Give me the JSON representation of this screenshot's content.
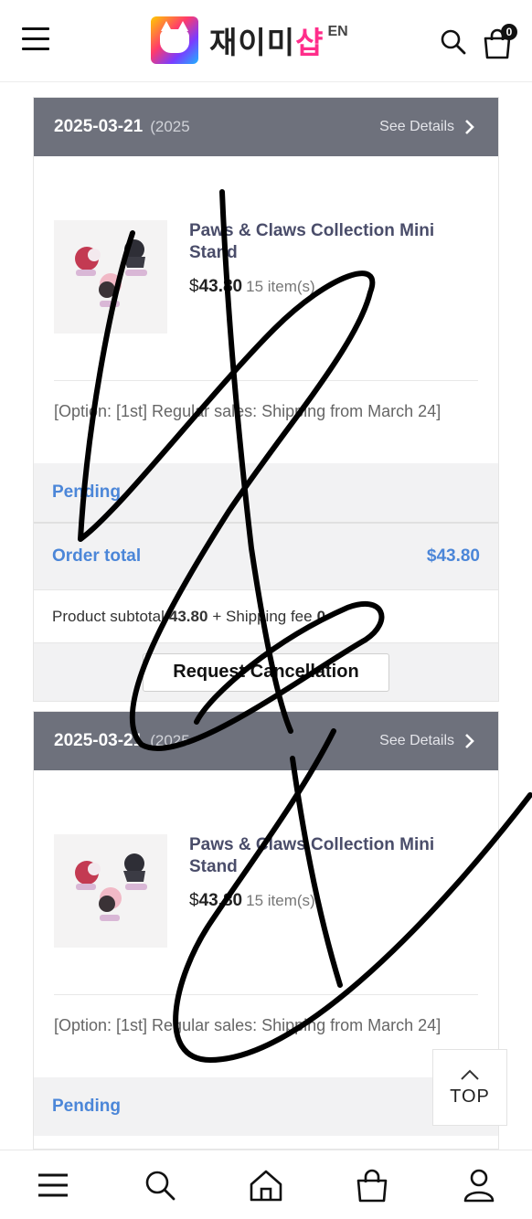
{
  "header": {
    "logo_text": "재이미",
    "logo_text_pink": "샵",
    "logo_lang": "EN",
    "cart_count": "0"
  },
  "orders": [
    {
      "date": "2025-03-21",
      "order_no": "(2025",
      "see_details": "See Details",
      "item_name": "Paws & Claws Collection Mini Stand",
      "price_prefix": "$",
      "price": "43.80",
      "qty": "15 item(s)",
      "option": "[Option: [1st] Regular sales: Shipping from March 24]",
      "status": "Pending",
      "order_total_label": "Order total",
      "order_total_value": "$43.80",
      "subtotal_label": "Product subtotal",
      "subtotal_value": "43.80",
      "shipping_label": "+ Shipping fee",
      "shipping_value": "0",
      "cancel_label": "Request Cancellation"
    },
    {
      "date": "2025-03-21",
      "order_no": "(2025",
      "see_details": "See Details",
      "item_name": "Paws & Claws Collection Mini Stand",
      "price_prefix": "$",
      "price": "43.80",
      "qty": "15 item(s)",
      "option": "[Option: [1st] Regular sales: Shipping from March 24]",
      "status": "Pending"
    }
  ],
  "top_button": {
    "label": "TOP"
  },
  "bottom_nav": {
    "items": [
      "menu-icon",
      "search-icon",
      "home-icon",
      "shopping-bag-icon",
      "user-icon"
    ]
  },
  "colors": {
    "accent_blue": "#4b86d8",
    "order_header": "#6e717c",
    "brand_pink": "#ff2d8a"
  }
}
